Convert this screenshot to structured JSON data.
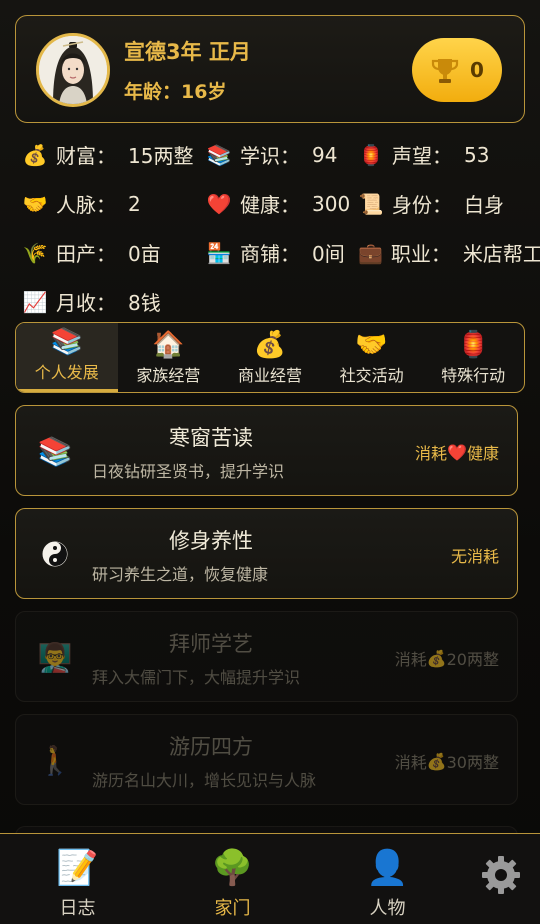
{
  "header": {
    "date": "宣德3年 正月",
    "age": "年龄：16岁",
    "trophy_count": "0"
  },
  "stats": [
    {
      "icon": "money-bag-icon",
      "glyph": "💰",
      "label": "财富：",
      "value": "15两整"
    },
    {
      "icon": "books-icon",
      "glyph": "📚",
      "label": "学识：",
      "value": "94"
    },
    {
      "icon": "lantern-icon",
      "glyph": "🏮",
      "label": "声望：",
      "value": "53"
    },
    {
      "icon": "handshake-icon",
      "glyph": "🤝",
      "label": "人脉：",
      "value": "2"
    },
    {
      "icon": "heart-icon",
      "glyph": "❤️",
      "label": "健康：",
      "value": "300"
    },
    {
      "icon": "scroll-icon",
      "glyph": "📜",
      "label": "身份：",
      "value": "白身"
    },
    {
      "icon": "rice-icon",
      "glyph": "🌾",
      "label": "田产：",
      "value": "0亩"
    },
    {
      "icon": "shop-icon",
      "glyph": "🏪",
      "label": "商铺：",
      "value": "0间"
    },
    {
      "icon": "briefcase-icon",
      "glyph": "💼",
      "label": "职业：",
      "value": "米店帮工"
    },
    {
      "icon": "chart-icon",
      "glyph": "📈",
      "label": "月收：",
      "value": "8钱"
    }
  ],
  "tabs": [
    {
      "label": "个人发展",
      "glyph": "📚",
      "icon": "books-icon",
      "active": true
    },
    {
      "label": "家族经营",
      "glyph": "🏠",
      "icon": "house-icon",
      "active": false
    },
    {
      "label": "商业经营",
      "glyph": "💰",
      "icon": "money-bag-icon",
      "active": false
    },
    {
      "label": "社交活动",
      "glyph": "🤝",
      "icon": "handshake-icon",
      "active": false
    },
    {
      "label": "特殊行动",
      "glyph": "🏮",
      "icon": "lantern-icon",
      "active": false
    }
  ],
  "actions": [
    {
      "title": "寒窗苦读",
      "desc": "日夜钻研圣贤书，提升学识",
      "cost_prefix": "消耗",
      "cost_glyph": "❤️",
      "cost_text": "健康",
      "glyph": "📚",
      "icon": "books-icon",
      "enabled": true
    },
    {
      "title": "修身养性",
      "desc": "研习养生之道，恢复健康",
      "cost_prefix": "无消耗",
      "cost_glyph": "",
      "cost_text": "",
      "glyph": "☯",
      "icon": "yin-yang-icon",
      "enabled": true
    },
    {
      "title": "拜师学艺",
      "desc": "拜入大儒门下，大幅提升学识",
      "cost_prefix": "消耗",
      "cost_glyph": "💰",
      "cost_text": "20两整",
      "glyph": "👨‍🏫",
      "icon": "teacher-icon",
      "enabled": false
    },
    {
      "title": "游历四方",
      "desc": "游历名山大川，增长见识与人脉",
      "cost_prefix": "消耗",
      "cost_glyph": "💰",
      "cost_text": "30两整",
      "glyph": "🚶",
      "icon": "walking-person-icon",
      "enabled": false
    }
  ],
  "nav": [
    {
      "label": "日志",
      "glyph": "📝",
      "icon": "memo-icon",
      "active": false
    },
    {
      "label": "家门",
      "glyph": "🌳",
      "icon": "tree-icon",
      "active": true
    },
    {
      "label": "人物",
      "glyph": "👤",
      "icon": "person-icon",
      "active": false
    }
  ],
  "colors": {
    "accent_gold": "#e8b949",
    "border_gold": "#b9953a",
    "background": "#0e0d0b"
  }
}
